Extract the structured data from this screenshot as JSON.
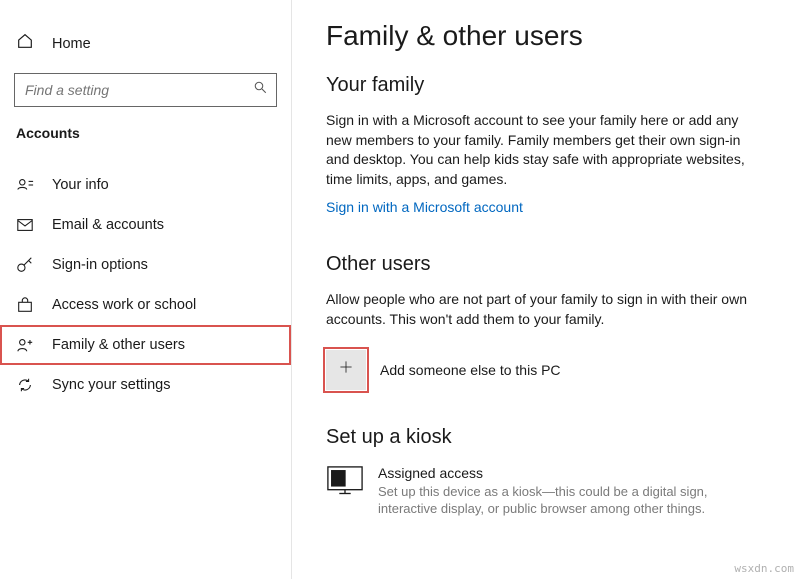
{
  "sidebar": {
    "home_label": "Home",
    "search_placeholder": "Find a setting",
    "category": "Accounts",
    "items": [
      {
        "label": "Your info",
        "icon": "user-card-icon"
      },
      {
        "label": "Email & accounts",
        "icon": "mail-icon"
      },
      {
        "label": "Sign-in options",
        "icon": "key-icon"
      },
      {
        "label": "Access work or school",
        "icon": "briefcase-icon"
      },
      {
        "label": "Family & other users",
        "icon": "family-icon"
      },
      {
        "label": "Sync your settings",
        "icon": "sync-icon"
      }
    ]
  },
  "main": {
    "page_title": "Family & other users",
    "family": {
      "heading": "Your family",
      "description": "Sign in with a Microsoft account to see your family here or add any new members to your family. Family members get their own sign-in and desktop. You can help kids stay safe with appropriate websites, time limits, apps, and games.",
      "link_text": "Sign in with a Microsoft account"
    },
    "other_users": {
      "heading": "Other users",
      "description": "Allow people who are not part of your family to sign in with their own accounts. This won't add them to your family.",
      "add_label": "Add someone else to this PC"
    },
    "kiosk": {
      "heading": "Set up a kiosk",
      "item_title": "Assigned access",
      "item_desc": "Set up this device as a kiosk—this could be a digital sign, interactive display, or public browser among other things."
    }
  },
  "watermark": "wsxdn.com"
}
